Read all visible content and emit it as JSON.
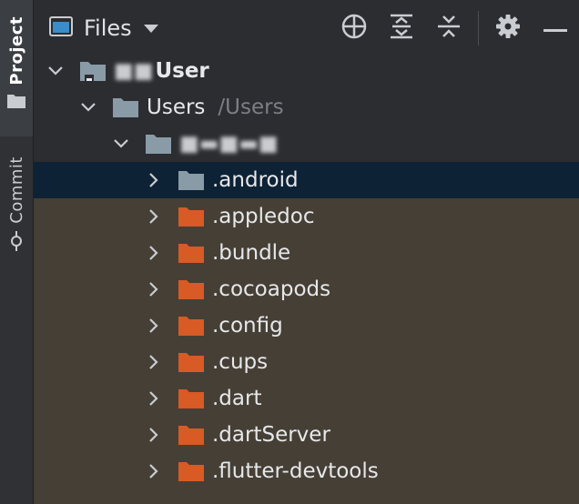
{
  "sidebar": {
    "project_label": "Project",
    "commit_label": "Commit"
  },
  "header": {
    "view_title": "Files",
    "tools": [
      {
        "icon": "locate-icon"
      },
      {
        "icon": "expand-all-icon"
      },
      {
        "icon": "collapse-all-icon"
      },
      {
        "icon": "gear-icon"
      },
      {
        "icon": "minimize-icon"
      }
    ]
  },
  "tree": {
    "root_label": "User",
    "users_label": "Users",
    "users_path_hint": "/Users",
    "items": [
      {
        "label": ".android",
        "color": "#8a9ba8"
      },
      {
        "label": ".appledoc",
        "color": "#d85a25"
      },
      {
        "label": ".bundle",
        "color": "#d85a25"
      },
      {
        "label": ".cocoapods",
        "color": "#d85a25"
      },
      {
        "label": ".config",
        "color": "#d85a25"
      },
      {
        "label": ".cups",
        "color": "#d85a25"
      },
      {
        "label": ".dart",
        "color": "#d85a25"
      },
      {
        "label": ".dartServer",
        "color": "#d85a25"
      },
      {
        "label": ".flutter-devtools",
        "color": "#d85a25"
      }
    ]
  },
  "colors": {
    "excluded_folder": "#d85a25",
    "normal_folder": "#8a9ba8",
    "selection": "#0d2235"
  }
}
